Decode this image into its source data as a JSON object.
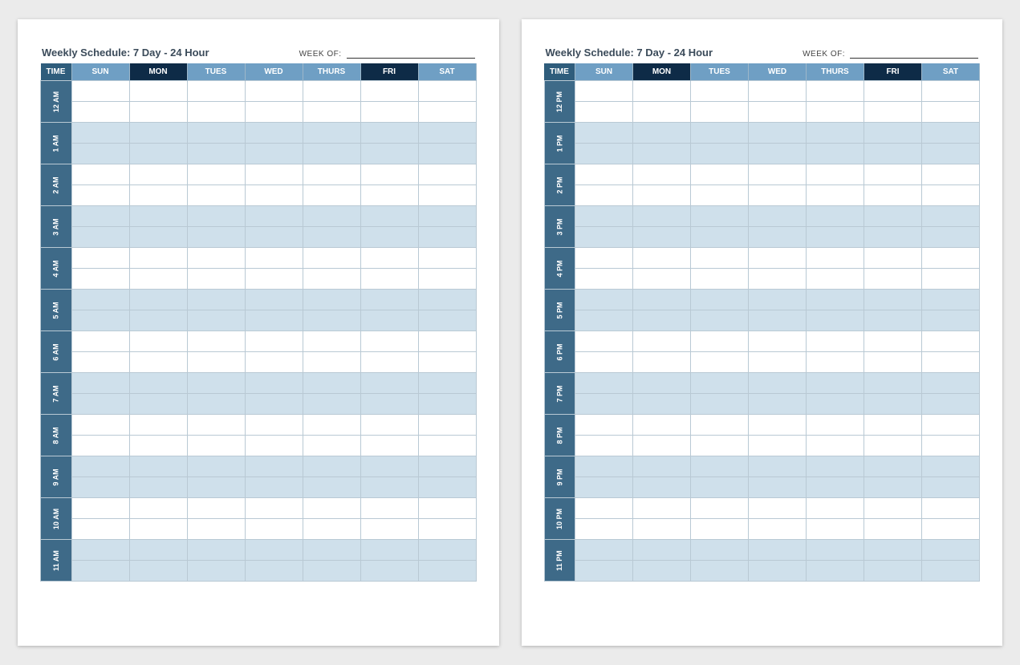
{
  "template": {
    "title": "Weekly Schedule: 7 Day - 24 Hour",
    "week_of_label": "WEEK OF:",
    "time_header": "TIME",
    "days": [
      "SUN",
      "MON",
      "TUES",
      "WED",
      "THURS",
      "FRI",
      "SAT"
    ],
    "dark_days": [
      "MON",
      "FRI"
    ]
  },
  "pages": [
    {
      "hours": [
        "12 AM",
        "1 AM",
        "2 AM",
        "3 AM",
        "4 AM",
        "5 AM",
        "6 AM",
        "7 AM",
        "8 AM",
        "9 AM",
        "10 AM",
        "11 AM"
      ]
    },
    {
      "hours": [
        "12 PM",
        "1 PM",
        "2 PM",
        "3 PM",
        "4 PM",
        "5 PM",
        "6 PM",
        "7 PM",
        "8 PM",
        "9 PM",
        "10 PM",
        "11 PM"
      ]
    }
  ]
}
